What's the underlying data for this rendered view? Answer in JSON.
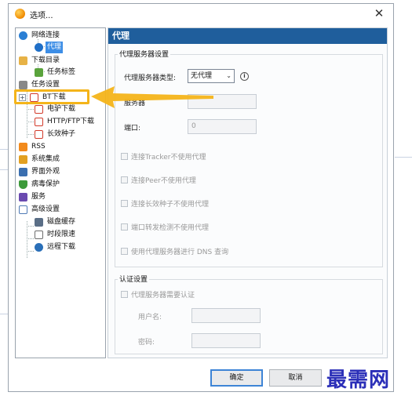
{
  "window": {
    "title": "选项..."
  },
  "tree": {
    "items": [
      {
        "label": "网络连接",
        "icon": "network-globe-icon",
        "color": "#2a7fd4"
      },
      {
        "label": "代理",
        "icon": "proxy-globe-icon",
        "color": "#1f6fc7"
      },
      {
        "label": "下载目录",
        "icon": "folder-icon",
        "color": "#e7b246"
      },
      {
        "label": "任务标签",
        "icon": "tag-icon",
        "color": "#5aa33c"
      },
      {
        "label": "任务设置",
        "icon": "task-settings-icon",
        "color": "#888888"
      },
      {
        "label": "BT下载",
        "icon": "bt-download-icon",
        "color": "#d23a2a"
      },
      {
        "label": "电驴下载",
        "icon": "ed2k-download-icon",
        "color": "#d23a2a"
      },
      {
        "label": "HTTP/FTP下载",
        "icon": "http-ftp-download-icon",
        "color": "#d23a2a"
      },
      {
        "label": "长效种子",
        "icon": "long-seed-icon",
        "color": "#d23a2a"
      },
      {
        "label": "RSS",
        "icon": "rss-icon",
        "color": "#f28a1c"
      },
      {
        "label": "系统集成",
        "icon": "system-integration-icon",
        "color": "#e2a021"
      },
      {
        "label": "界面外观",
        "icon": "appearance-icon",
        "color": "#3b6fb0"
      },
      {
        "label": "病毒保护",
        "icon": "shield-icon",
        "color": "#3c9a3a"
      },
      {
        "label": "服务",
        "icon": "service-icon",
        "color": "#6a4ab0"
      },
      {
        "label": "高级设置",
        "icon": "advanced-settings-icon",
        "color": "#4f7bb6"
      },
      {
        "label": "磁盘缓存",
        "icon": "disk-cache-icon",
        "color": "#5a6e86"
      },
      {
        "label": "时段限速",
        "icon": "speed-limit-icon",
        "color": "#6d6d6d"
      },
      {
        "label": "远程下载",
        "icon": "remote-download-icon",
        "color": "#2a6fb8"
      }
    ]
  },
  "panel": {
    "header": "代理",
    "proxy_group": {
      "title": "代理服务器设置",
      "type_label": "代理服务器类型:",
      "type_value": "无代理",
      "server_label": "服务器",
      "port_label": "端口:",
      "port_value": "0",
      "checkboxes": [
        "连接Tracker不使用代理",
        "连接Peer不使用代理",
        "连接长效种子不使用代理",
        "端口转发检测不使用代理",
        "使用代理服务器进行 DNS 查询"
      ]
    },
    "auth_group": {
      "title": "认证设置",
      "checkbox": "代理服务器需要认证",
      "username_label": "用户名:",
      "password_label": "密码:"
    }
  },
  "buttons": {
    "ok": "确定",
    "cancel": "取消"
  },
  "annotation": {
    "highlight_color": "#f4b41a"
  },
  "watermark": "最需网"
}
